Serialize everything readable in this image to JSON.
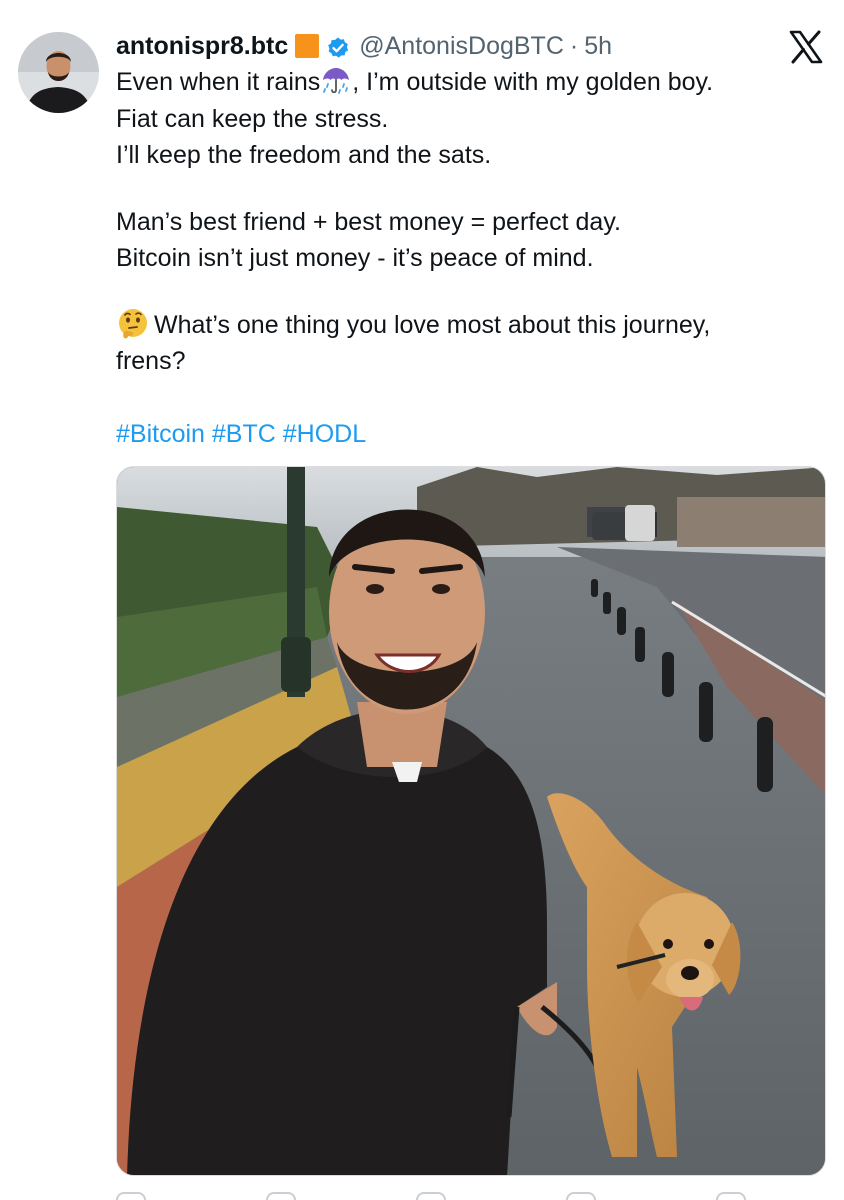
{
  "author": {
    "display_name": "antonispr8.btc",
    "handle": "@AntonisDogBTC",
    "separator": "·",
    "time": "5h",
    "badge_color": "#f7931a",
    "verified_icon": "verified-badge-icon"
  },
  "platform": {
    "logo_icon": "x-logo-icon"
  },
  "post": {
    "line1_pre": "Even when it rains",
    "line1_post": ", I’m outside with my golden boy.",
    "line2": "Fiat can keep the stress.",
    "line3": "I’ll keep the freedom and the sats.",
    "line4": "Man’s best friend + best money = perfect day.",
    "line5": "Bitcoin isn’t just money -  it’s peace of mind.",
    "line6": "What’s one thing you love most about this journey,",
    "line7": "frens?",
    "emoji_rain": "umbrella-rain-icon",
    "emoji_think": "thinking-face-icon"
  },
  "hashtags": [
    "#Bitcoin",
    "#BTC",
    "#HODL"
  ],
  "media": {
    "alt_subject": "selfie-with-golden-retriever-photo"
  },
  "colors": {
    "link": "#1d9bf0",
    "secondary_text": "#536471",
    "bitcoin_orange": "#f7931a"
  }
}
